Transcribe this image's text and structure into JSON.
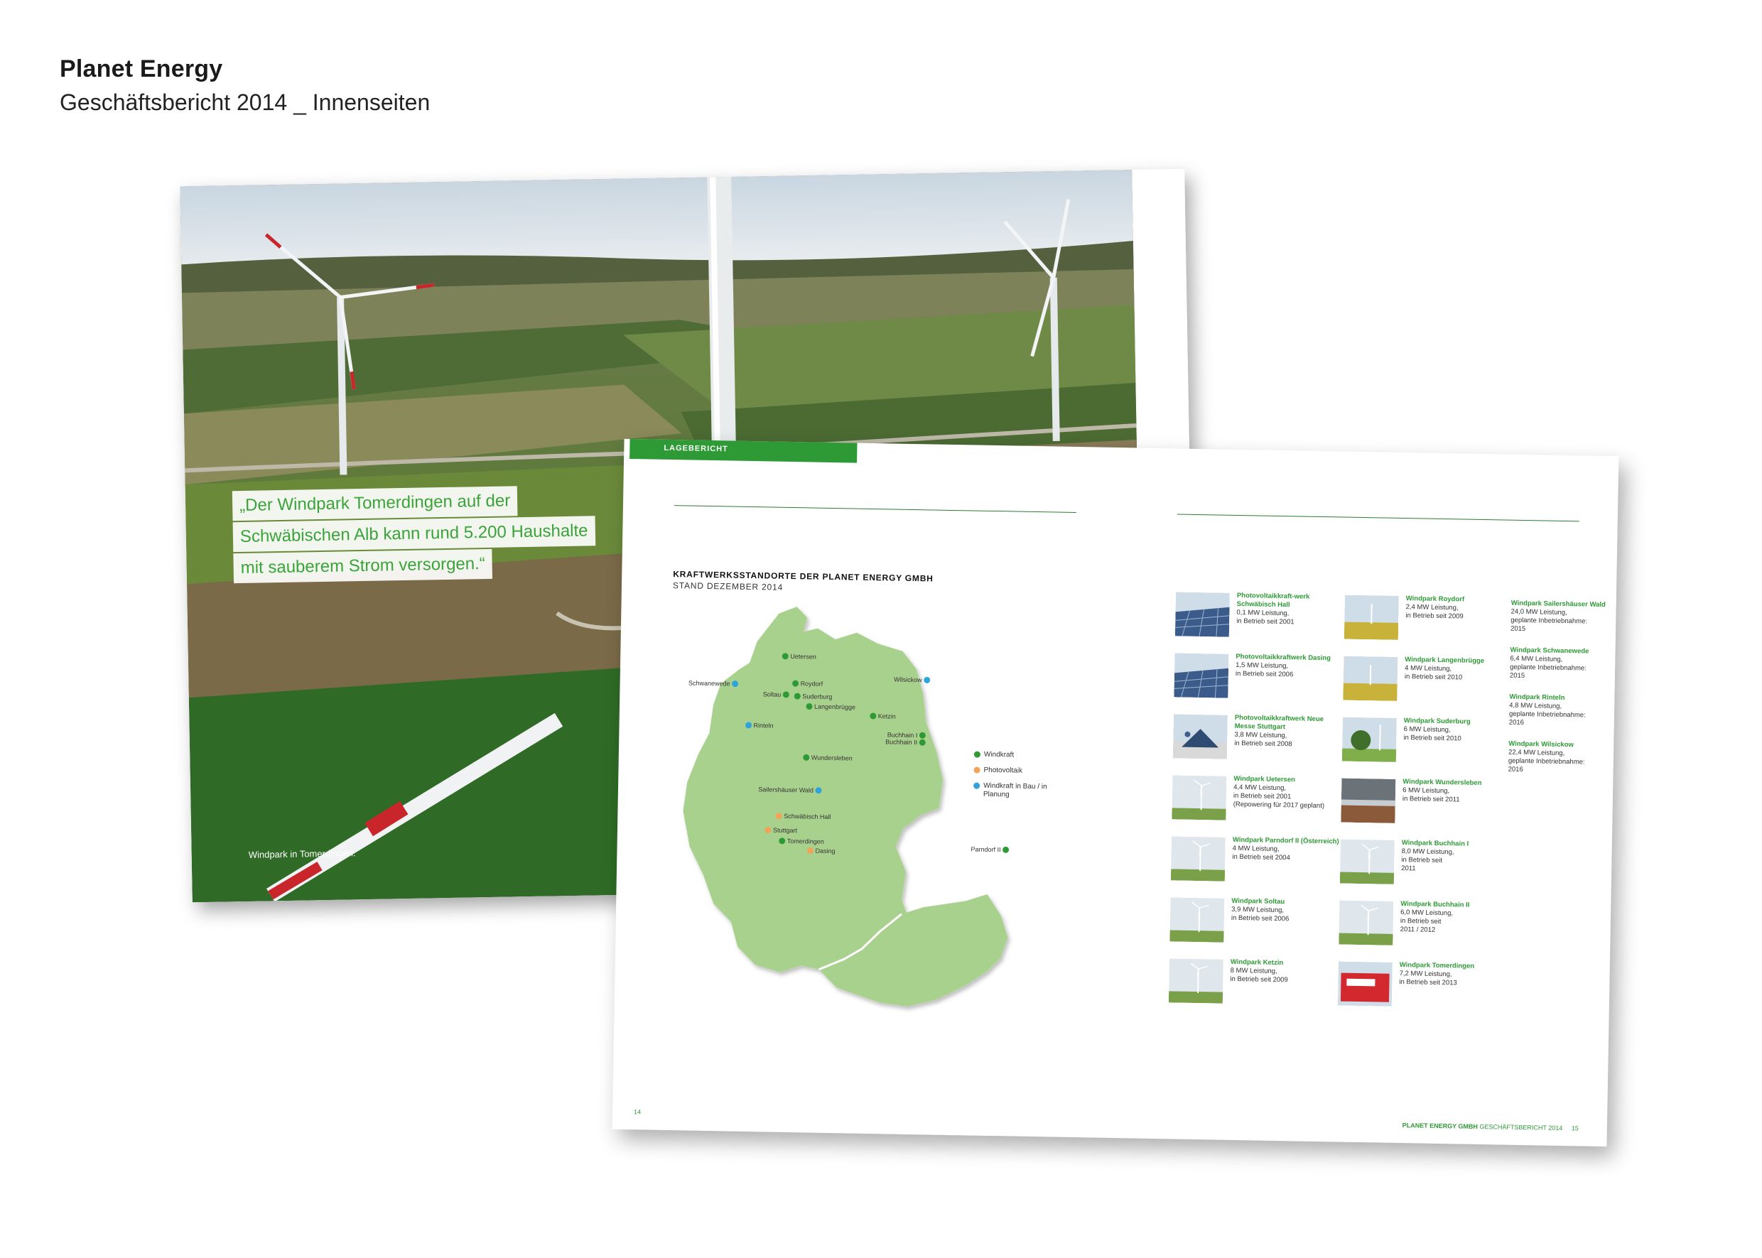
{
  "header": {
    "title": "Planet Energy",
    "subtitle": "Geschäftsbericht 2014 _ Innenseiten"
  },
  "left_page": {
    "quote_lines": [
      "„Der Windpark Tomerdingen auf der",
      "Schwäbischen Alb kann rund 5.200 Haushalte",
      "mit sauberem Strom versorgen.“"
    ],
    "caption": "Windpark in Tomerdingen."
  },
  "right_page": {
    "section_tab": "LAGEBERICHT",
    "map_title": "KRAFTWERKSSTANDORTE DER PLANET ENERGY GMBH",
    "map_subtitle": "STAND DEZEMBER 2014",
    "colors": {
      "wind": "#2e9a36",
      "solar": "#f2a35a",
      "planned": "#2fa4dc",
      "land": "#a9d18e"
    },
    "map_labels": [
      {
        "name": "Uetersen",
        "type": "wind"
      },
      {
        "name": "Schwanewede",
        "type": "planned"
      },
      {
        "name": "Roydorf",
        "type": "wind"
      },
      {
        "name": "Soltau",
        "type": "wind"
      },
      {
        "name": "Suderburg",
        "type": "wind"
      },
      {
        "name": "Wilsickow",
        "type": "planned"
      },
      {
        "name": "Langenbrügge",
        "type": "wind"
      },
      {
        "name": "Ketzin",
        "type": "wind"
      },
      {
        "name": "Rinteln",
        "type": "planned"
      },
      {
        "name": "Buchhain I",
        "type": "wind"
      },
      {
        "name": "Buchhain II",
        "type": "wind"
      },
      {
        "name": "Wundersleben",
        "type": "wind"
      },
      {
        "name": "Sailershäuser Wald",
        "type": "planned"
      },
      {
        "name": "Schwäbisch Hall",
        "type": "solar"
      },
      {
        "name": "Stuttgart",
        "type": "solar"
      },
      {
        "name": "Tomerdingen",
        "type": "wind"
      },
      {
        "name": "Dasing",
        "type": "solar"
      },
      {
        "name": "Parndorf II",
        "type": "wind"
      }
    ],
    "legend": [
      {
        "label": "Windkraft",
        "type": "wind"
      },
      {
        "label": "Photovoltaik",
        "type": "solar"
      },
      {
        "label": "Windkraft in Bau / in Planung",
        "type": "planned"
      }
    ],
    "plants_col1": [
      {
        "name": "Photovoltaikkraft-werk Schwäbisch Hall",
        "detail": "0,1 MW Leistung,\nin Betrieb seit 2001",
        "thumb": "solar"
      },
      {
        "name": "Photovoltaikkraftwerk Dasing",
        "detail": "1,5 MW Leistung,\nin Betrieb seit 2006",
        "thumb": "solar"
      },
      {
        "name": "Photovoltaikkraftwerk Neue Messe Stuttgart",
        "detail": "3,8 MW Leistung,\nin Betrieb seit 2008",
        "thumb": "roof"
      },
      {
        "name": "Windpark Uetersen",
        "detail": "4,4 MW Leistung,\nin Betrieb seit 2001\n(Repowering für 2017 geplant)",
        "thumb": "wind"
      },
      {
        "name": "Windpark Parndorf II (Österreich)",
        "detail": "4 MW Leistung,\nin Betrieb seit 2004",
        "thumb": "wind"
      },
      {
        "name": "Windpark Soltau",
        "detail": "3,9 MW Leistung,\nin Betrieb seit 2006",
        "thumb": "wind"
      },
      {
        "name": "Windpark Ketzin",
        "detail": "8 MW Leistung,\nin Betrieb seit 2009",
        "thumb": "wind"
      }
    ],
    "plants_col2": [
      {
        "name": "Windpark Roydorf",
        "detail": "2,4 MW Leistung,\nin Betrieb seit 2009",
        "thumb": "field"
      },
      {
        "name": "Windpark Langenbrügge",
        "detail": "4 MW Leistung,\nin Betrieb seit 2010",
        "thumb": "field"
      },
      {
        "name": "Windpark Suderburg",
        "detail": "6 MW Leistung,\nin Betrieb seit 2010",
        "thumb": "tree"
      },
      {
        "name": "Windpark Wundersleben",
        "detail": "6 MW Leistung,\nin Betrieb seit 2011",
        "thumb": "dark"
      },
      {
        "name": "Windpark Buchhain I",
        "detail": "8,0 MW Leistung,\nin Betrieb seit\n2011",
        "thumb": "wind"
      },
      {
        "name": "Windpark Buchhain II",
        "detail": "6,0 MW Leistung,\nin Betrieb seit\n2011 / 2012",
        "thumb": "wind"
      },
      {
        "name": "Windpark Tomerdingen",
        "detail": "7,2 MW Leistung,\nin Betrieb seit 2013",
        "thumb": "red"
      }
    ],
    "plants_col3": [
      {
        "name": "Windpark Sailershäuser Wald",
        "detail": "24,0 MW Leistung,\ngeplante Inbetriebnahme:\n2015"
      },
      {
        "name": "Windpark Schwanewede",
        "detail": "6,4 MW Leistung,\ngeplante Inbetriebnahme:\n2015"
      },
      {
        "name": "Windpark Rinteln",
        "detail": "4,8 MW Leistung,\ngeplante Inbetriebnahme:\n2016"
      },
      {
        "name": "Windpark Wilsickow",
        "detail": "22,4 MW Leistung,\ngeplante Inbetriebnahme:\n2016"
      }
    ],
    "footer": {
      "page_left": "14",
      "brand": "PLANET ENERGY GMBH",
      "report": "GESCHÄFTSBERICHT 2014",
      "page_right": "15"
    }
  }
}
